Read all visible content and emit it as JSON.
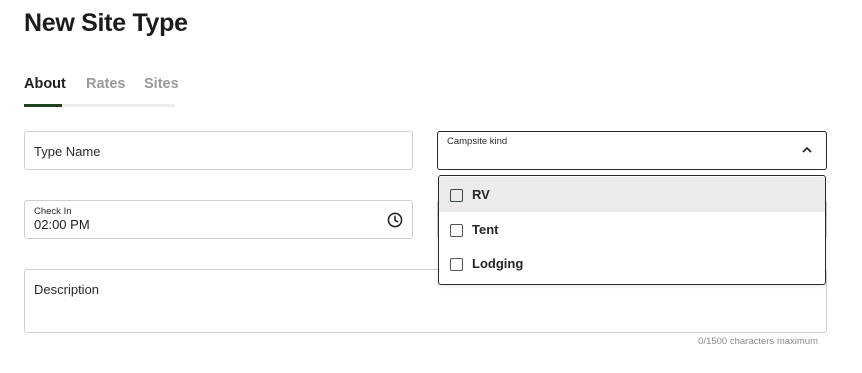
{
  "page": {
    "title": "New Site Type"
  },
  "tabs": [
    {
      "label": "About",
      "active": true
    },
    {
      "label": "Rates",
      "active": false
    },
    {
      "label": "Sites",
      "active": false
    }
  ],
  "form": {
    "type_name": {
      "placeholder": "Type Name",
      "value": ""
    },
    "campsite_kind": {
      "label": "Campsite kind",
      "expanded": true,
      "options": [
        {
          "label": "RV",
          "checked": false,
          "hovered": true
        },
        {
          "label": "Tent",
          "checked": false,
          "hovered": false
        },
        {
          "label": "Lodging",
          "checked": false,
          "hovered": false
        }
      ]
    },
    "check_in": {
      "label": "Check In",
      "value": "02:00 PM",
      "icon": "clock-icon"
    },
    "description": {
      "placeholder": "Description",
      "helper": "0/1500 characters maximum"
    }
  },
  "colors": {
    "accent": "#20401f",
    "border": "#cfcfcf",
    "hover_bg": "#ececec"
  }
}
